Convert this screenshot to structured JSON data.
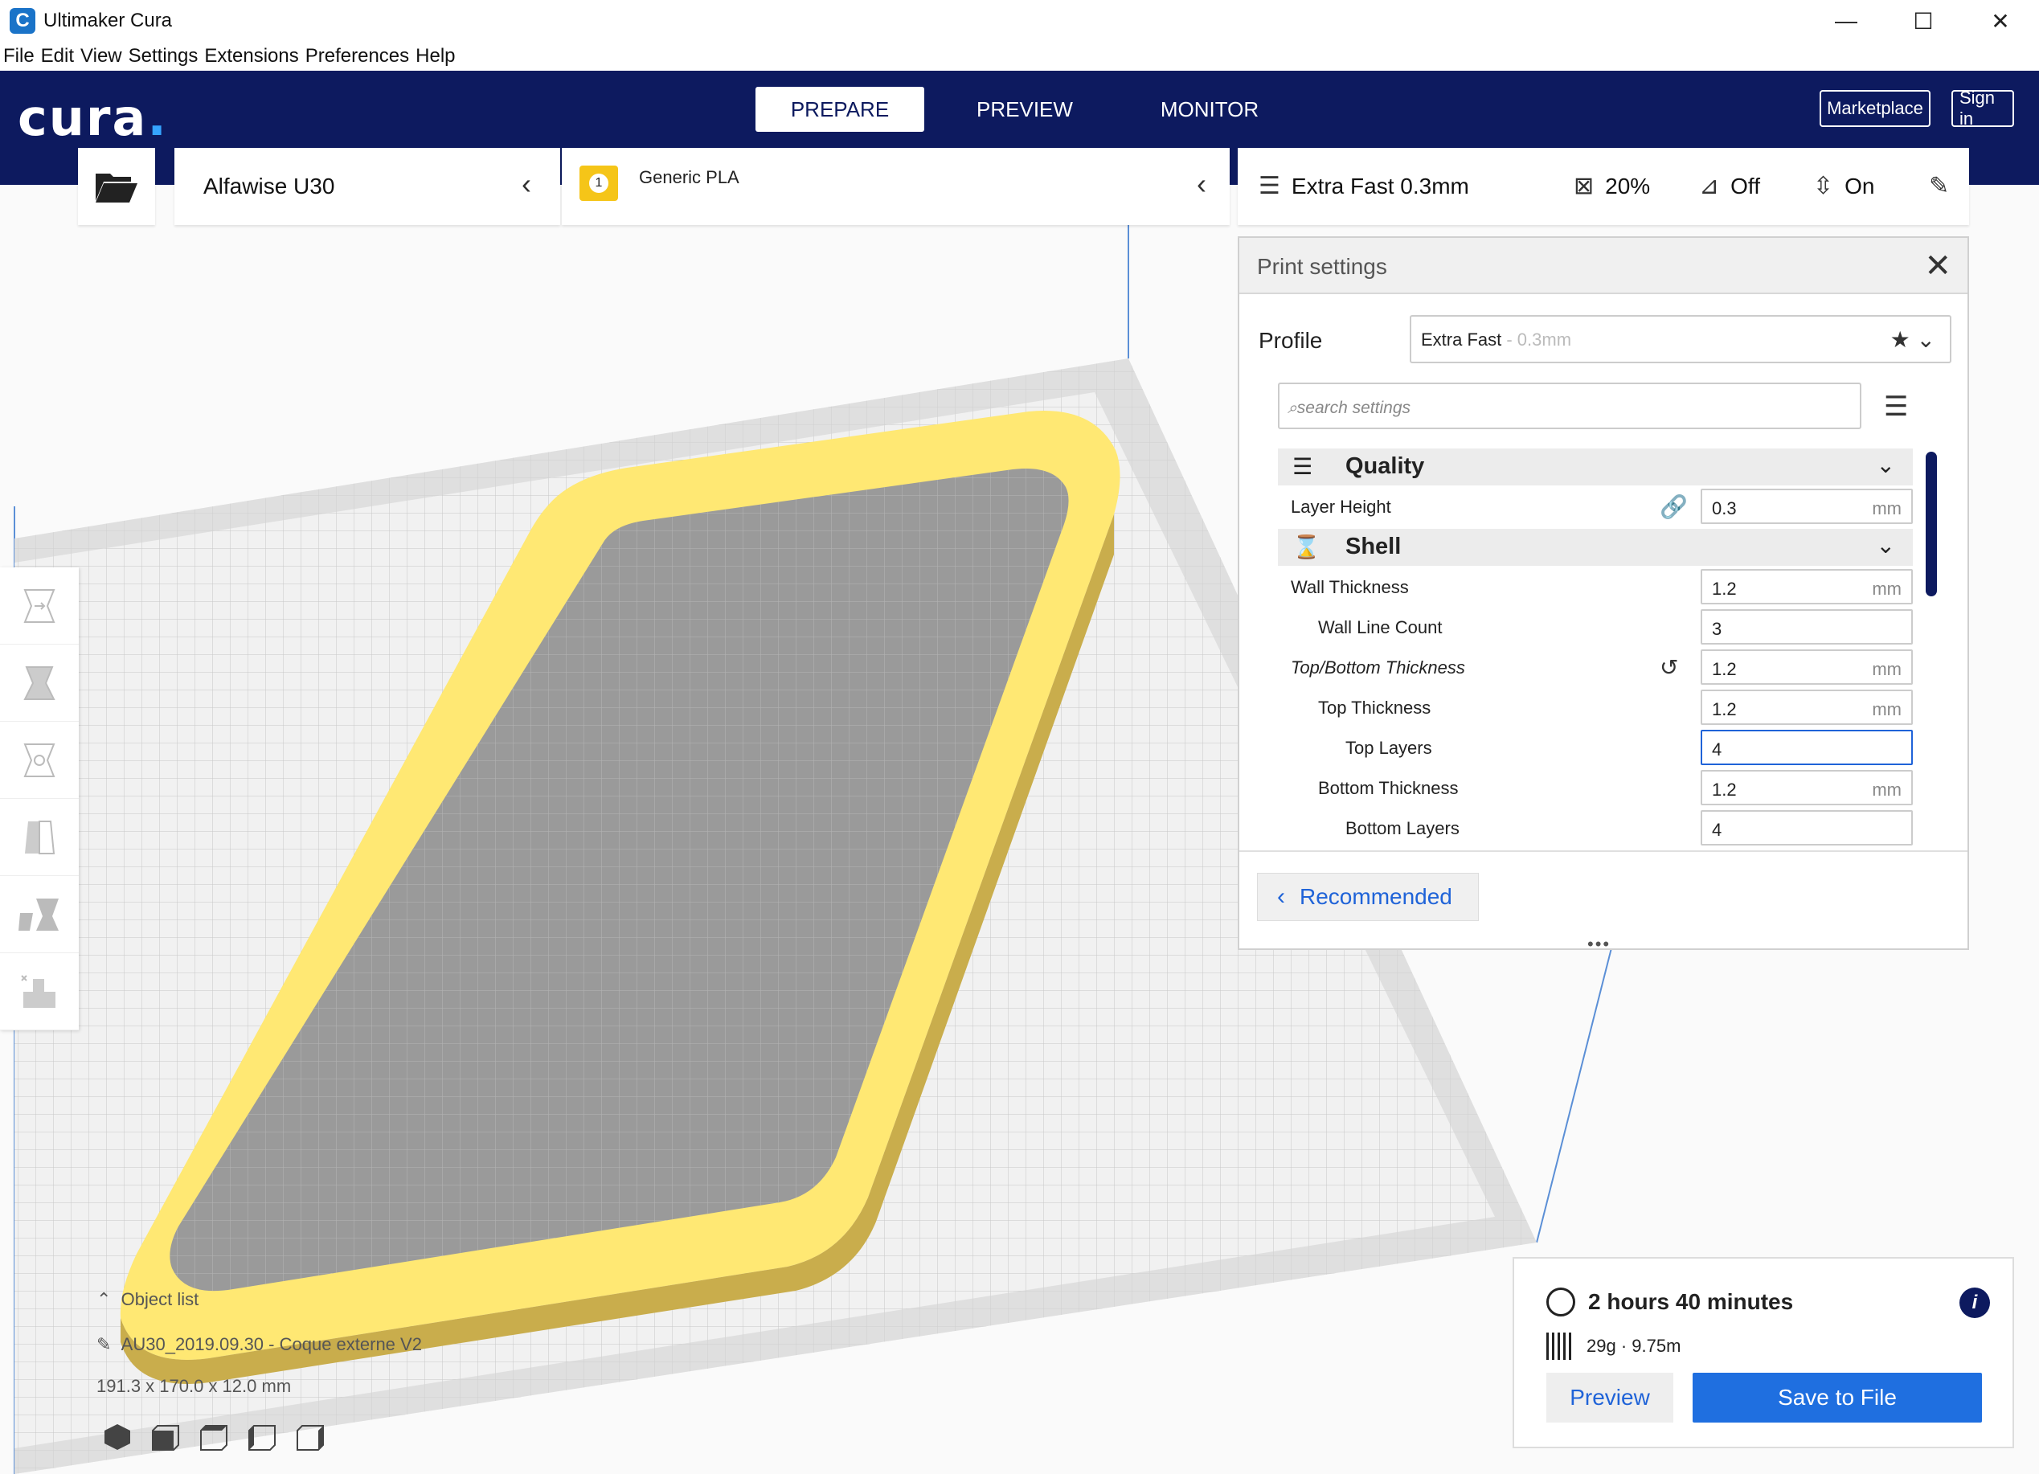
{
  "window": {
    "title": "Ultimaker Cura",
    "icon_letter": "C",
    "minimize": "—",
    "maximize": "☐",
    "close": "✕"
  },
  "menubar": [
    "File",
    "Edit",
    "View",
    "Settings",
    "Extensions",
    "Preferences",
    "Help"
  ],
  "header": {
    "logo": "cura",
    "logo_dot": ".",
    "tabs": [
      {
        "label": "PREPARE",
        "active": true
      },
      {
        "label": "PREVIEW",
        "active": false
      },
      {
        "label": "MONITOR",
        "active": false
      }
    ],
    "marketplace": "Marketplace",
    "signin": "Sign in"
  },
  "machine": {
    "name": "Alfawise U30"
  },
  "material": {
    "extruder_number": "1",
    "name": "Generic PLA"
  },
  "print_summary": {
    "profile": "Extra Fast 0.3mm",
    "infill": "20%",
    "support": "Off",
    "adhesion": "On"
  },
  "print_settings": {
    "title": "Print settings",
    "profile_label": "Profile",
    "profile_value": "Extra Fast",
    "profile_sub": " - 0.3mm",
    "search_placeholder": "search settings",
    "categories": {
      "quality": "Quality",
      "shell": "Shell"
    },
    "settings": [
      {
        "label": "Layer Height",
        "value": "0.3",
        "unit": "mm"
      },
      {
        "label": "Wall Thickness",
        "value": "1.2",
        "unit": "mm"
      },
      {
        "label": "Wall Line Count",
        "value": "3",
        "unit": ""
      },
      {
        "label": "Top/Bottom Thickness",
        "value": "1.2",
        "unit": "mm"
      },
      {
        "label": "Top Thickness",
        "value": "1.2",
        "unit": "mm"
      },
      {
        "label": "Top Layers",
        "value": "4",
        "unit": ""
      },
      {
        "label": "Bottom Thickness",
        "value": "1.2",
        "unit": "mm"
      },
      {
        "label": "Bottom Layers",
        "value": "4",
        "unit": ""
      }
    ],
    "recommended": "Recommended",
    "dots": "•••"
  },
  "object": {
    "list_label": "Object list",
    "name": "AU30_2019.09.30 - Coque externe V2",
    "dimensions": "191.3 x 170.0 x 12.0 mm"
  },
  "output": {
    "time": "2 hours 40 minutes",
    "material": "29g · 9.75m",
    "preview": "Preview",
    "save": "Save to File",
    "info": "i"
  },
  "colors": {
    "header": "#0d1a5f",
    "accent": "#1f6fe0",
    "model": "#ffe873",
    "model_inner": "#9a9a9a"
  },
  "icons": {
    "open": "folder-open-icon",
    "infill": "infill-icon",
    "support": "support-icon",
    "adhesion": "adhesion-icon",
    "edit": "pencil-icon"
  }
}
